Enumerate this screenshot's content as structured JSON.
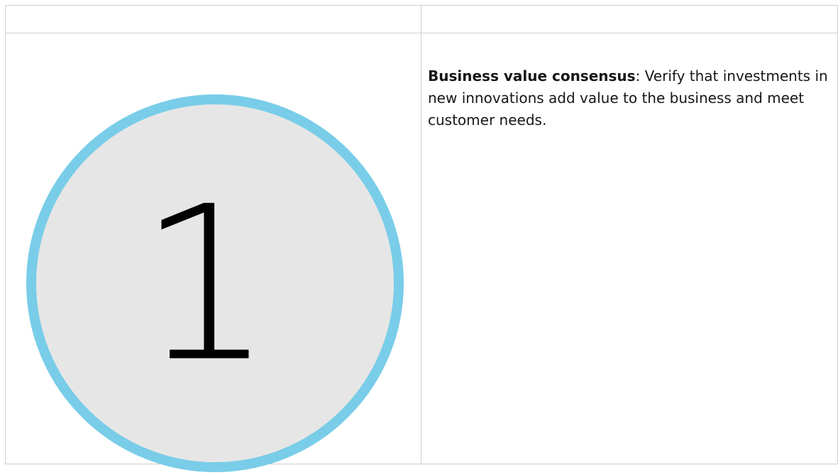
{
  "table": {
    "header": [
      "",
      ""
    ],
    "rows": [
      {
        "step_badge": {
          "number": "1",
          "ring_color": "#79cde8",
          "fill_color": "#e6e6e6",
          "icon": "numbered-step-circle-icon"
        },
        "term": "Business value consensus",
        "separator": ":",
        "description": " Verify that investments in new innovations add value to the business and meet customer needs."
      }
    ]
  }
}
